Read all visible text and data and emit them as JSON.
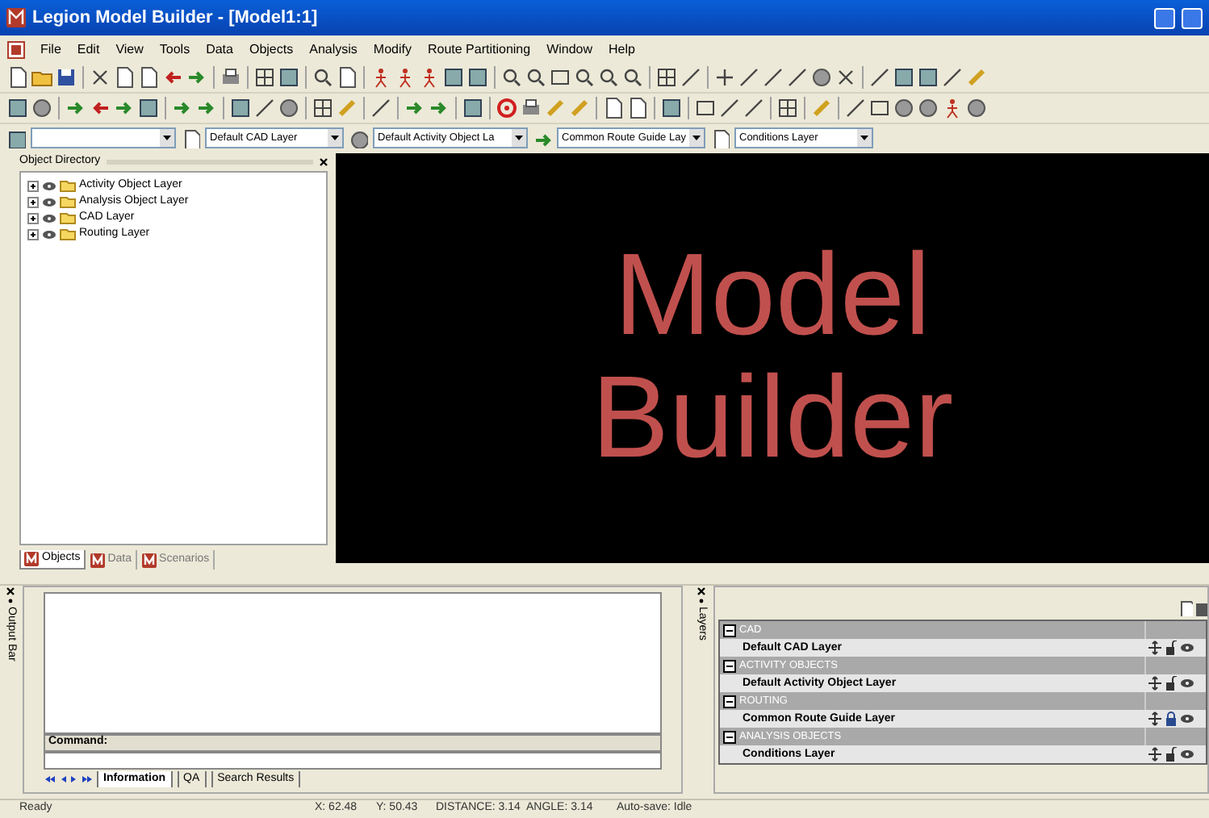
{
  "window": {
    "title": "Legion Model Builder - [Model1:1]"
  },
  "menu": [
    "File",
    "Edit",
    "View",
    "Tools",
    "Data",
    "Objects",
    "Analysis",
    "Modify",
    "Route Partitioning",
    "Window",
    "Help"
  ],
  "layer_combos": [
    {
      "value": "Default CAD Layer"
    },
    {
      "value": "Default Activity Object La"
    },
    {
      "value": "Common Route Guide Lay"
    },
    {
      "value": "Conditions Layer"
    }
  ],
  "object_directory": {
    "title": "Object Directory",
    "items": [
      {
        "label": "Activity Object Layer",
        "expanded": false
      },
      {
        "label": "Analysis Object Layer",
        "expanded": false
      },
      {
        "label": "CAD Layer",
        "expanded": false
      },
      {
        "label": "Routing Layer",
        "expanded": false
      }
    ],
    "tabs": [
      {
        "label": "Objects",
        "selected": true
      },
      {
        "label": "Data",
        "selected": false
      },
      {
        "label": "Scenarios",
        "selected": false
      }
    ]
  },
  "canvas": {
    "lines": [
      "Model",
      "Builder"
    ]
  },
  "output_bar": {
    "title": "Output Bar",
    "command_label": "Command:",
    "tabs": [
      {
        "label": "Information",
        "selected": true
      },
      {
        "label": "QA",
        "selected": false
      },
      {
        "label": "Search Results",
        "selected": false
      }
    ]
  },
  "layers_panel": {
    "title": "Layers",
    "groups": [
      {
        "name": "CAD",
        "expanded": true,
        "layers": [
          {
            "name": "Default CAD Layer",
            "locked": false
          }
        ]
      },
      {
        "name": "ACTIVITY OBJECTS",
        "expanded": true,
        "layers": [
          {
            "name": "Default Activity Object Layer",
            "locked": false
          }
        ]
      },
      {
        "name": "ROUTING",
        "expanded": true,
        "layers": [
          {
            "name": "Common Route Guide Layer",
            "locked": true
          }
        ]
      },
      {
        "name": "ANALYSIS OBJECTS",
        "expanded": true,
        "layers": [
          {
            "name": "Conditions Layer",
            "locked": false
          }
        ]
      }
    ]
  },
  "status_bar": [
    "Ready",
    "X: 62.48",
    "Y: 50.43",
    "DISTANCE: 3.14",
    "ANGLE: 3.14",
    "Auto-save: Idle"
  ]
}
